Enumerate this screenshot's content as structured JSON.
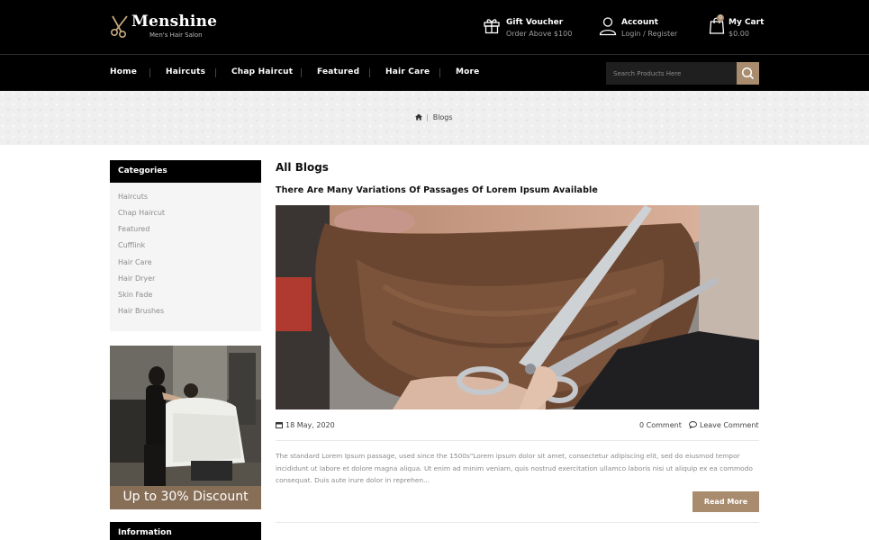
{
  "brand": {
    "name": "Menshine",
    "tagline": "Men's Hair Salon"
  },
  "header": {
    "gift": {
      "title": "Gift Voucher",
      "subtitle": "Order Above $100"
    },
    "account": {
      "title": "Account",
      "login": "Login",
      "separator": "/",
      "register": "Register"
    },
    "cart": {
      "title": "My Cart",
      "amount": "$0.00",
      "count": "0"
    }
  },
  "nav": {
    "items": [
      "Home",
      "Haircuts",
      "Chap Haircut",
      "Featured",
      "Hair Care",
      "More"
    ],
    "search_placeholder": "Search Products Here"
  },
  "breadcrumb": {
    "separator": "|",
    "current": "Blogs"
  },
  "sidebar": {
    "categories_title": "Categories",
    "categories": [
      "Haircuts",
      "Chap Haircut",
      "Featured",
      "Cufflink",
      "Hair Care",
      "Hair Dryer",
      "Skin Fade",
      "Hair Brushes"
    ],
    "promo_text": "Up to 30% Discount",
    "information_title": "Information"
  },
  "main": {
    "page_title": "All Blogs",
    "post": {
      "title": "There Are Many Variations Of Passages Of Lorem Ipsum Available",
      "date": "18 May, 2020",
      "comments": "0 Comment",
      "leave_comment": "Leave Comment",
      "excerpt": "The standard Lorem Ipsum passage, used since the 1500s\"Lorem ipsum dolor sit amet, consectetur adipiscing elit, sed do eiusmod tempor incididunt ut labore et dolore magna aliqua. Ut enim ad minim veniam, quis nostrud exercitation ullamco laboris nisi ut aliquip ex ea commodo consequat. Duis aute irure dolor in reprehen...",
      "read_more": "Read More"
    }
  },
  "colors": {
    "accent": "#a98c6d",
    "header_bg": "#000000",
    "sidebar_bg": "#f5f5f5"
  },
  "icons": {
    "logo": "scissors-icon",
    "gift": "gift-icon",
    "account": "user-icon",
    "cart": "shopping-bag-icon",
    "search": "search-icon",
    "home": "home-icon",
    "date": "calendar-icon",
    "comment": "comment-icon"
  }
}
